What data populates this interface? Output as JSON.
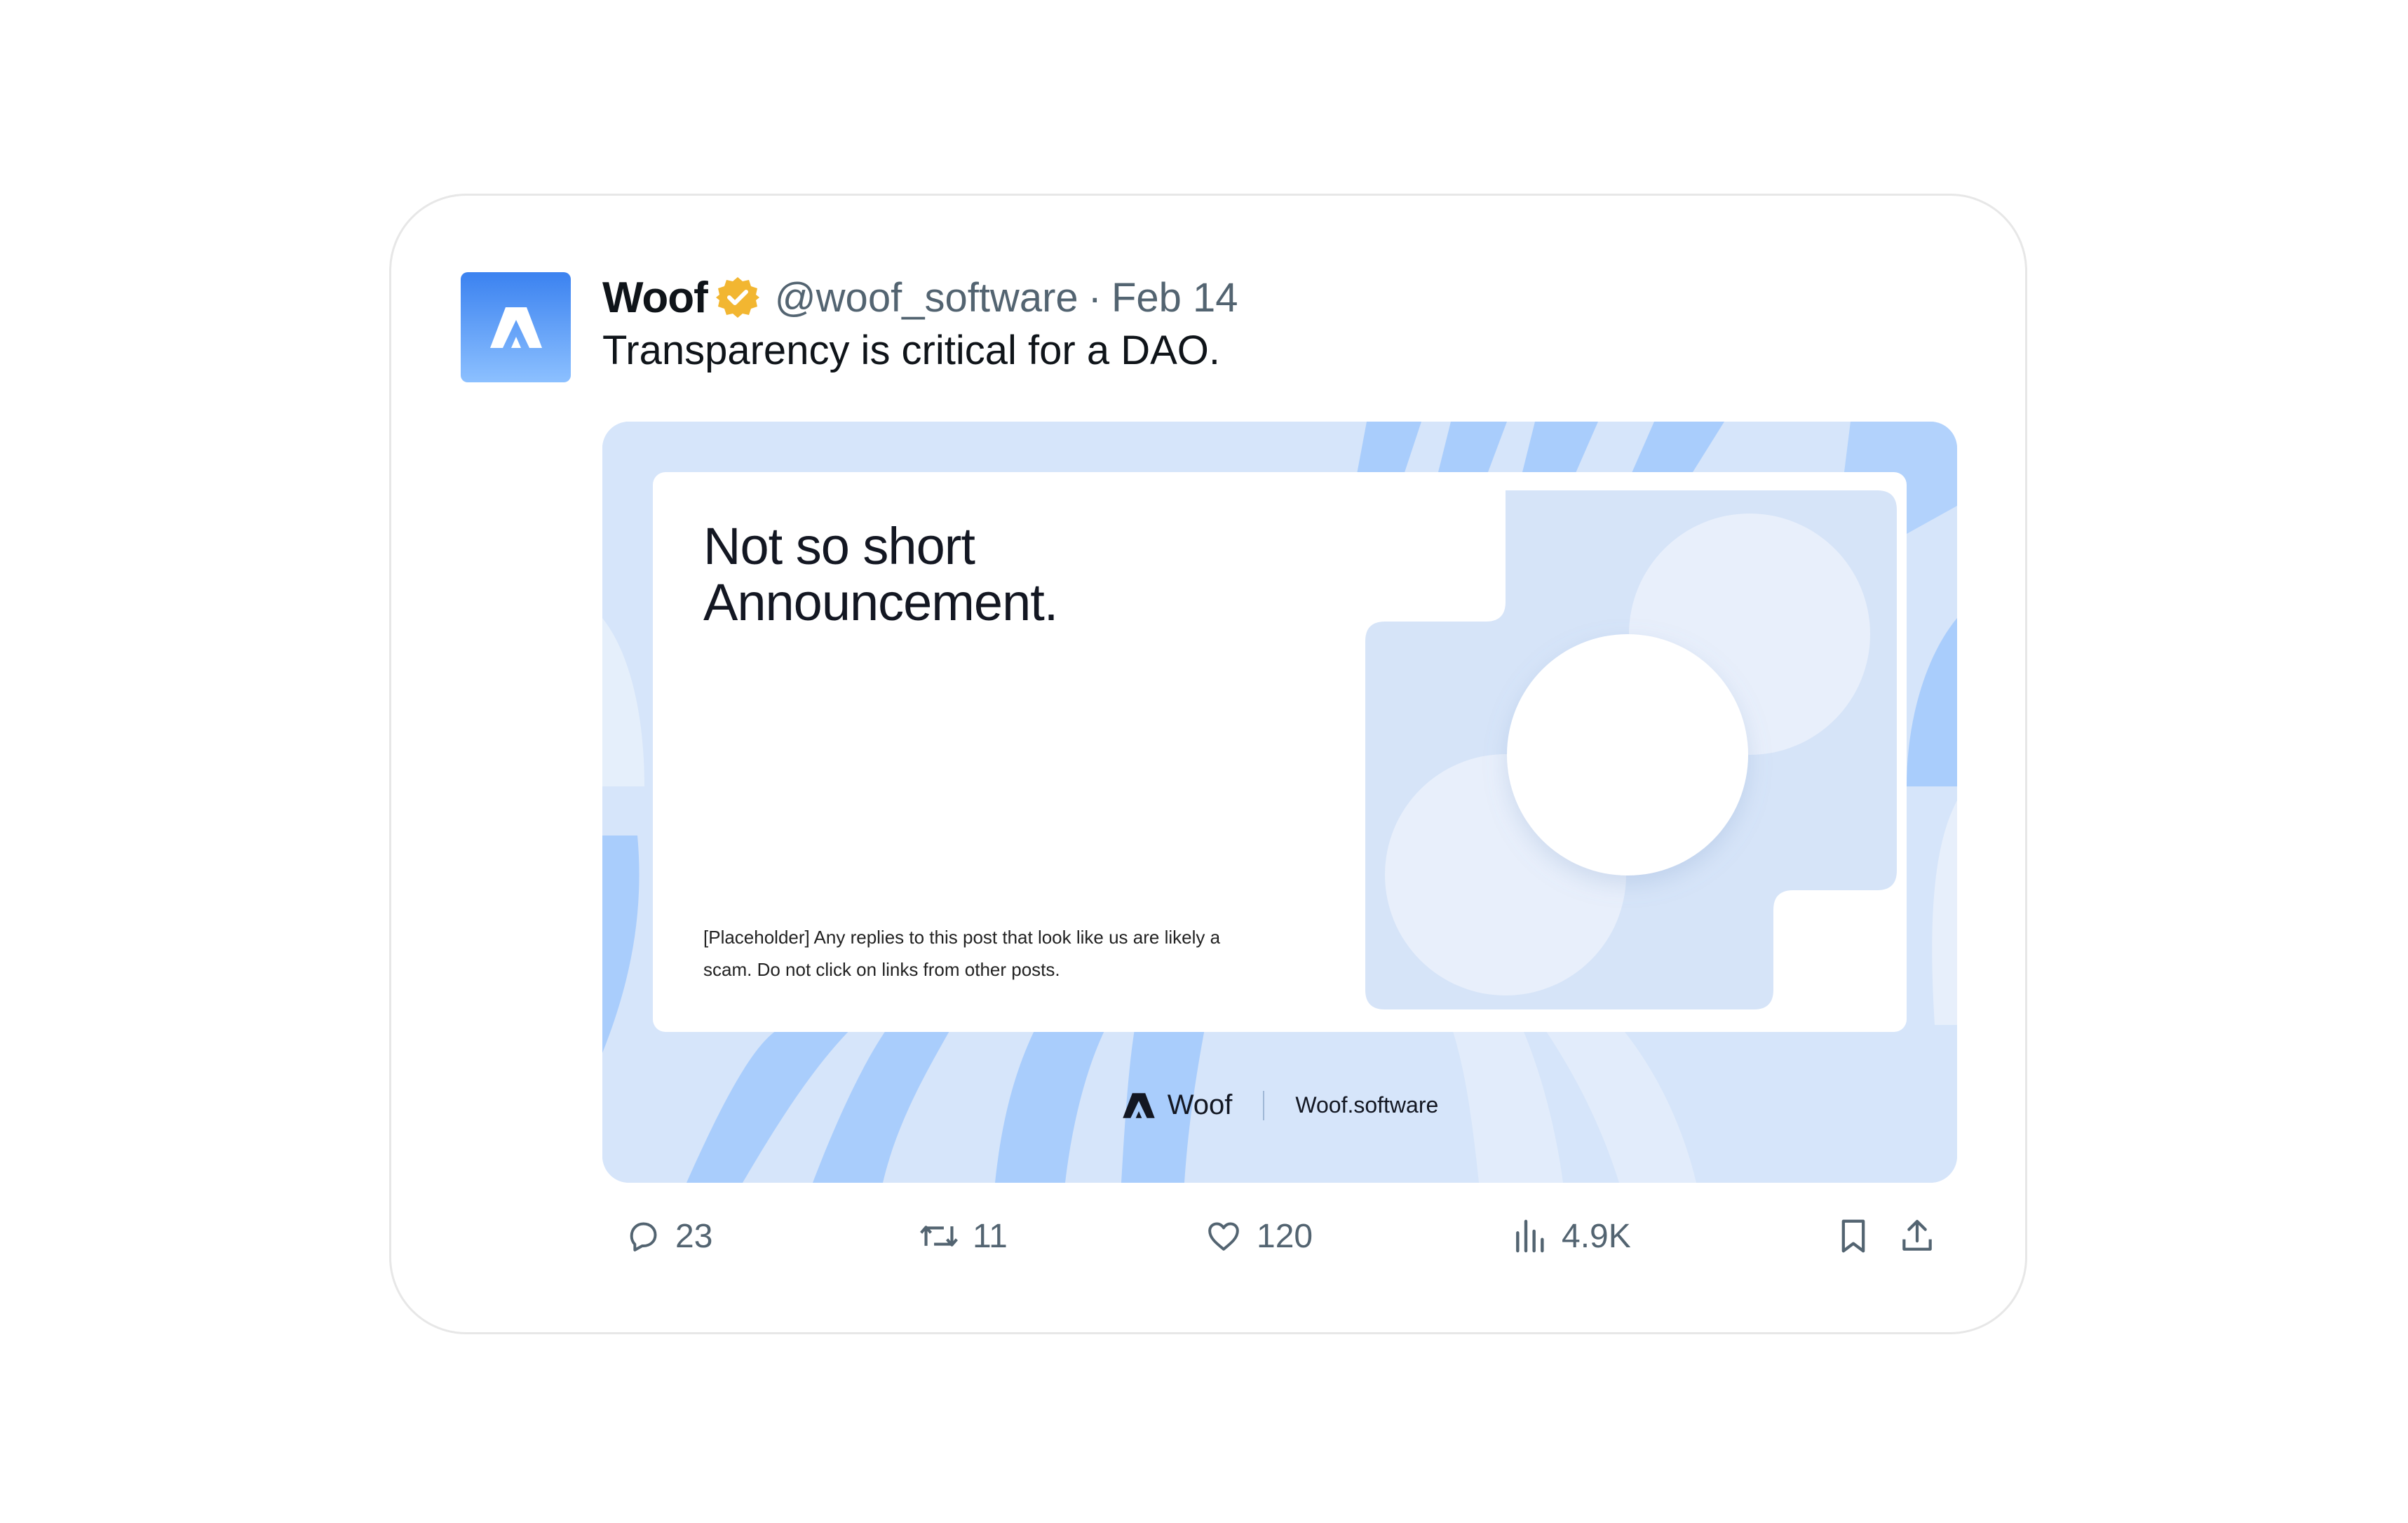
{
  "post": {
    "author_name": "Woof",
    "handle": "@woof_software",
    "separator": "·",
    "date": "Feb 14",
    "text": "Transparency is critical for a DAO."
  },
  "media": {
    "title_line1": "Not so short",
    "title_line2": "Announcement.",
    "disclaimer": "[Placeholder] Any replies to this post that look like us are likely a scam. Do not click on links from other posts.",
    "brand_name": "Woof",
    "brand_url": "Woof.software"
  },
  "actions": {
    "replies": "23",
    "reposts": "11",
    "likes": "120",
    "views": "4.9K"
  },
  "icons": {
    "avatar": "woof-logo-icon",
    "verified": "verified-badge-icon",
    "reply": "reply-icon",
    "repost": "repost-icon",
    "like": "heart-icon",
    "views": "bar-chart-icon",
    "bookmark": "bookmark-icon",
    "share": "share-icon"
  },
  "colors": {
    "verified_badge": "#f2b631",
    "avatar_top": "#3b82f0",
    "avatar_bottom": "#8cc0ff",
    "media_background": "#d6e5fa",
    "media_stripe": "#a9cdfc",
    "text_primary": "#0f1419",
    "text_secondary": "#536471"
  }
}
